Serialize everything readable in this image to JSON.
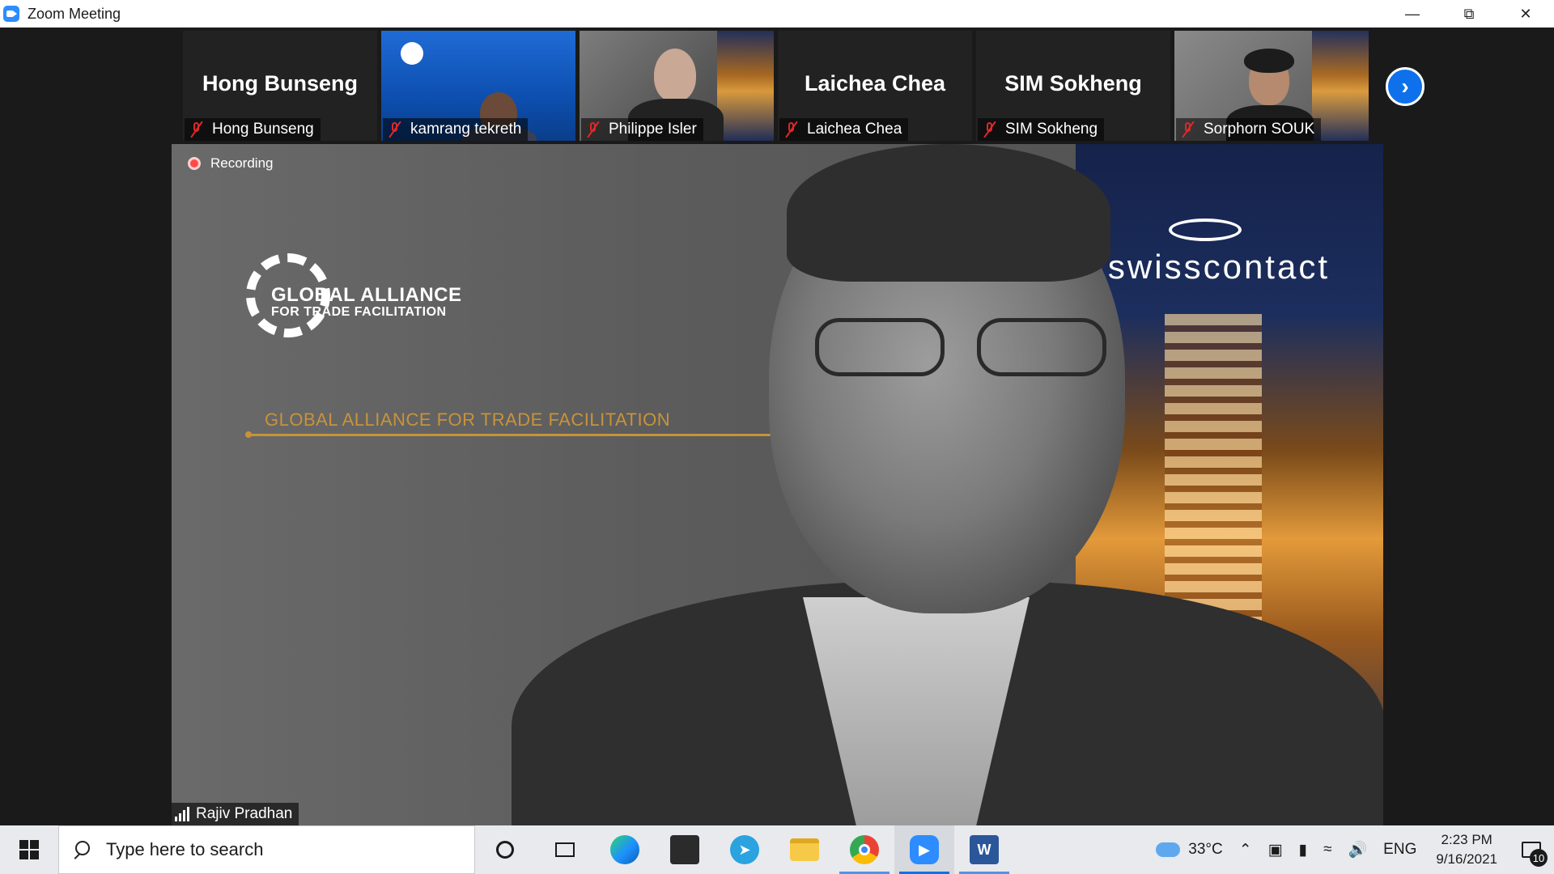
{
  "window": {
    "title": "Zoom Meeting",
    "minimize_icon": "minimize-icon",
    "restore_icon": "restore-icon",
    "close_icon": "close-icon"
  },
  "gallery": {
    "tiles": [
      {
        "display_name": "Hong Bunseng",
        "label": "Hong Bunseng",
        "muted": true,
        "video": false
      },
      {
        "display_name": "",
        "label": "kamrang tekreth",
        "muted": true,
        "video": true
      },
      {
        "display_name": "",
        "label": "Philippe Isler",
        "muted": true,
        "video": true
      },
      {
        "display_name": "Laichea Chea",
        "label": "Laichea Chea",
        "muted": true,
        "video": false
      },
      {
        "display_name": "SIM Sokheng",
        "label": "SIM Sokheng",
        "muted": true,
        "video": false
      },
      {
        "display_name": "",
        "label": "Sorphorn SOUK",
        "muted": true,
        "video": true
      }
    ],
    "next_icon": "chevron-right-icon"
  },
  "active_speaker": {
    "name": "Rajiv Pradhan",
    "recording_label": "Recording",
    "background_logo_title": "GLOBAL ALLIANCE",
    "background_logo_subtitle": "FOR TRADE FACILITATION",
    "background_banner": "GLOBAL ALLIANCE FOR TRADE FACILITATION",
    "background_brand": "swisscontact"
  },
  "taskbar": {
    "search_placeholder": "Type here to search",
    "weather_temp": "33°C",
    "language": "ENG",
    "time": "2:23 PM",
    "date": "9/16/2021",
    "notification_count": "10",
    "apps": [
      "cortana-icon",
      "task-view-icon",
      "edge-icon",
      "store-icon",
      "telegram-icon",
      "file-explorer-icon",
      "chrome-icon",
      "zoom-icon",
      "word-icon"
    ]
  },
  "colors": {
    "zoom_blue": "#0e71eb",
    "mute_red": "#e02828",
    "recording_red": "#ff4a4a",
    "banner_gold": "#c8933a"
  }
}
